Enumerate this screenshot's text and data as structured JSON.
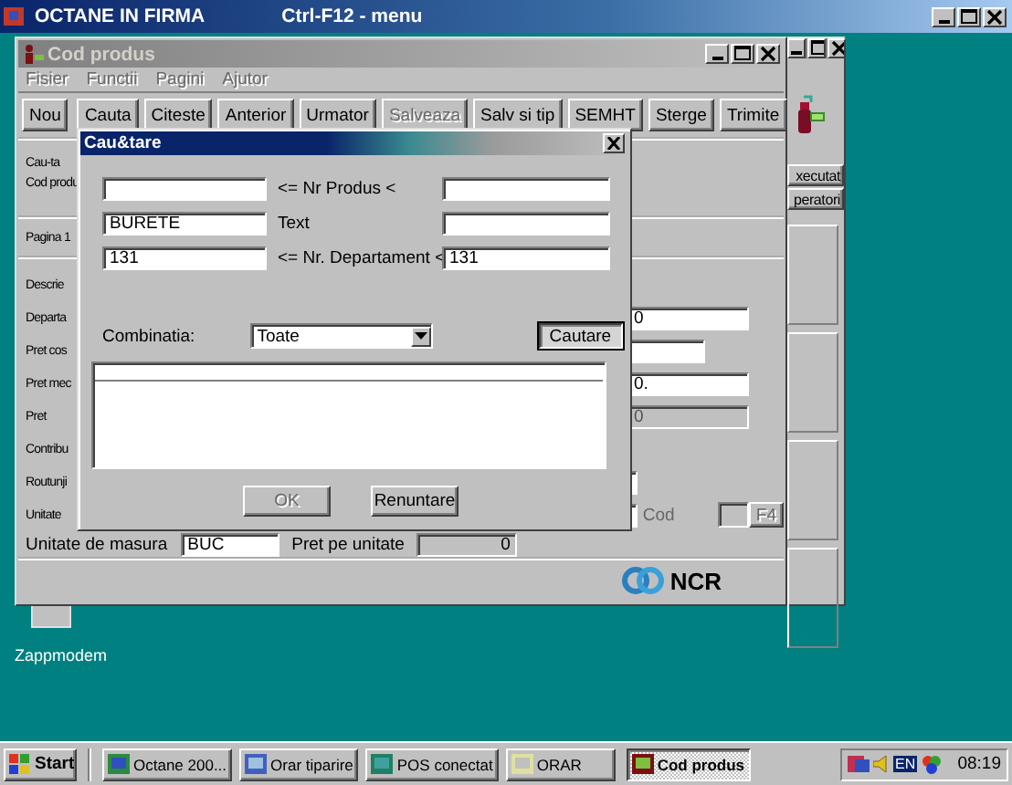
{
  "app_window": {
    "title": "OCTANE IN FIRMA",
    "menu_hint": "Ctrl-F12 - menu"
  },
  "back_window": {
    "buttons": [
      {
        "label": "xecutat"
      },
      {
        "label": "peratori"
      }
    ]
  },
  "product_window": {
    "title": "Cod produs",
    "active": false,
    "menu": [
      {
        "label": "Fisier",
        "disabled": true
      },
      {
        "label": "Functii",
        "disabled": true
      },
      {
        "label": "Pagini",
        "disabled": true
      },
      {
        "label": "Ajutor",
        "disabled": true
      }
    ],
    "toolbar": [
      {
        "label": "Nou",
        "disabled": false
      },
      {
        "label": "Cauta",
        "disabled": false
      },
      {
        "label": "Citeste",
        "disabled": false
      },
      {
        "label": "Anterior",
        "disabled": false
      },
      {
        "label": "Urmator",
        "disabled": false
      },
      {
        "label": "Salveaza",
        "disabled": true
      },
      {
        "label": "Salv si tip",
        "disabled": false
      },
      {
        "label": "SEMHT",
        "disabled": false
      },
      {
        "label": "Sterge",
        "disabled": false
      },
      {
        "label": "Trimite",
        "disabled": false
      }
    ],
    "search_label": "Cau-ta",
    "code_label": "Cod produ",
    "page_tab": "Pagina 1",
    "rows": [
      {
        "label": "Descrie",
        "kind": "none"
      },
      {
        "label": "Departa",
        "kind": "field",
        "value": "0",
        "disabled": false
      },
      {
        "label": "Pret cos",
        "kind": "short",
        "disabled": false
      },
      {
        "label": "Pret mec",
        "kind": "field",
        "value": "0.",
        "disabled": false
      },
      {
        "label": "Pret",
        "kind": "field",
        "value": "0",
        "disabled": true
      },
      {
        "label": "Contribu",
        "kind": "none"
      },
      {
        "label": "Routunji",
        "kind": "edge"
      },
      {
        "label": "Unitate",
        "kind": "code",
        "cod_label": "Cod",
        "f4_button": "F4"
      }
    ],
    "unit_label": "Unitate de masura",
    "unit_value": "BUC",
    "unit_price_label": "Pret pe unitate",
    "unit_price_value": "0",
    "brand": "NCR"
  },
  "search_dialog": {
    "title": "Cau&tare",
    "ranges": [
      {
        "label": "<= Nr Produs <"
      },
      {
        "from": "BURETE",
        "label": "Text"
      },
      {
        "from": "131",
        "label": "<= Nr. Departament <",
        "to": "131"
      }
    ],
    "combination_label": "Combinatia:",
    "combination_value": "Toate",
    "search_button": "Cautare",
    "buttons": [
      {
        "label": "OK",
        "disabled": true
      },
      {
        "label": "Renuntare",
        "disabled": false
      }
    ]
  },
  "desktop_icons": [
    {
      "label": "Zappmodem"
    }
  ],
  "taskbar": {
    "start": "Start",
    "tasks": [
      {
        "label": "Octane 200...",
        "selected": false
      },
      {
        "label": "Orar tiparire",
        "selected": false
      },
      {
        "label": "POS conectat",
        "selected": false
      },
      {
        "label": "ORAR",
        "selected": false
      },
      {
        "label": "Cod produs",
        "selected": true
      }
    ],
    "language": "EN",
    "clock": "08:19"
  }
}
